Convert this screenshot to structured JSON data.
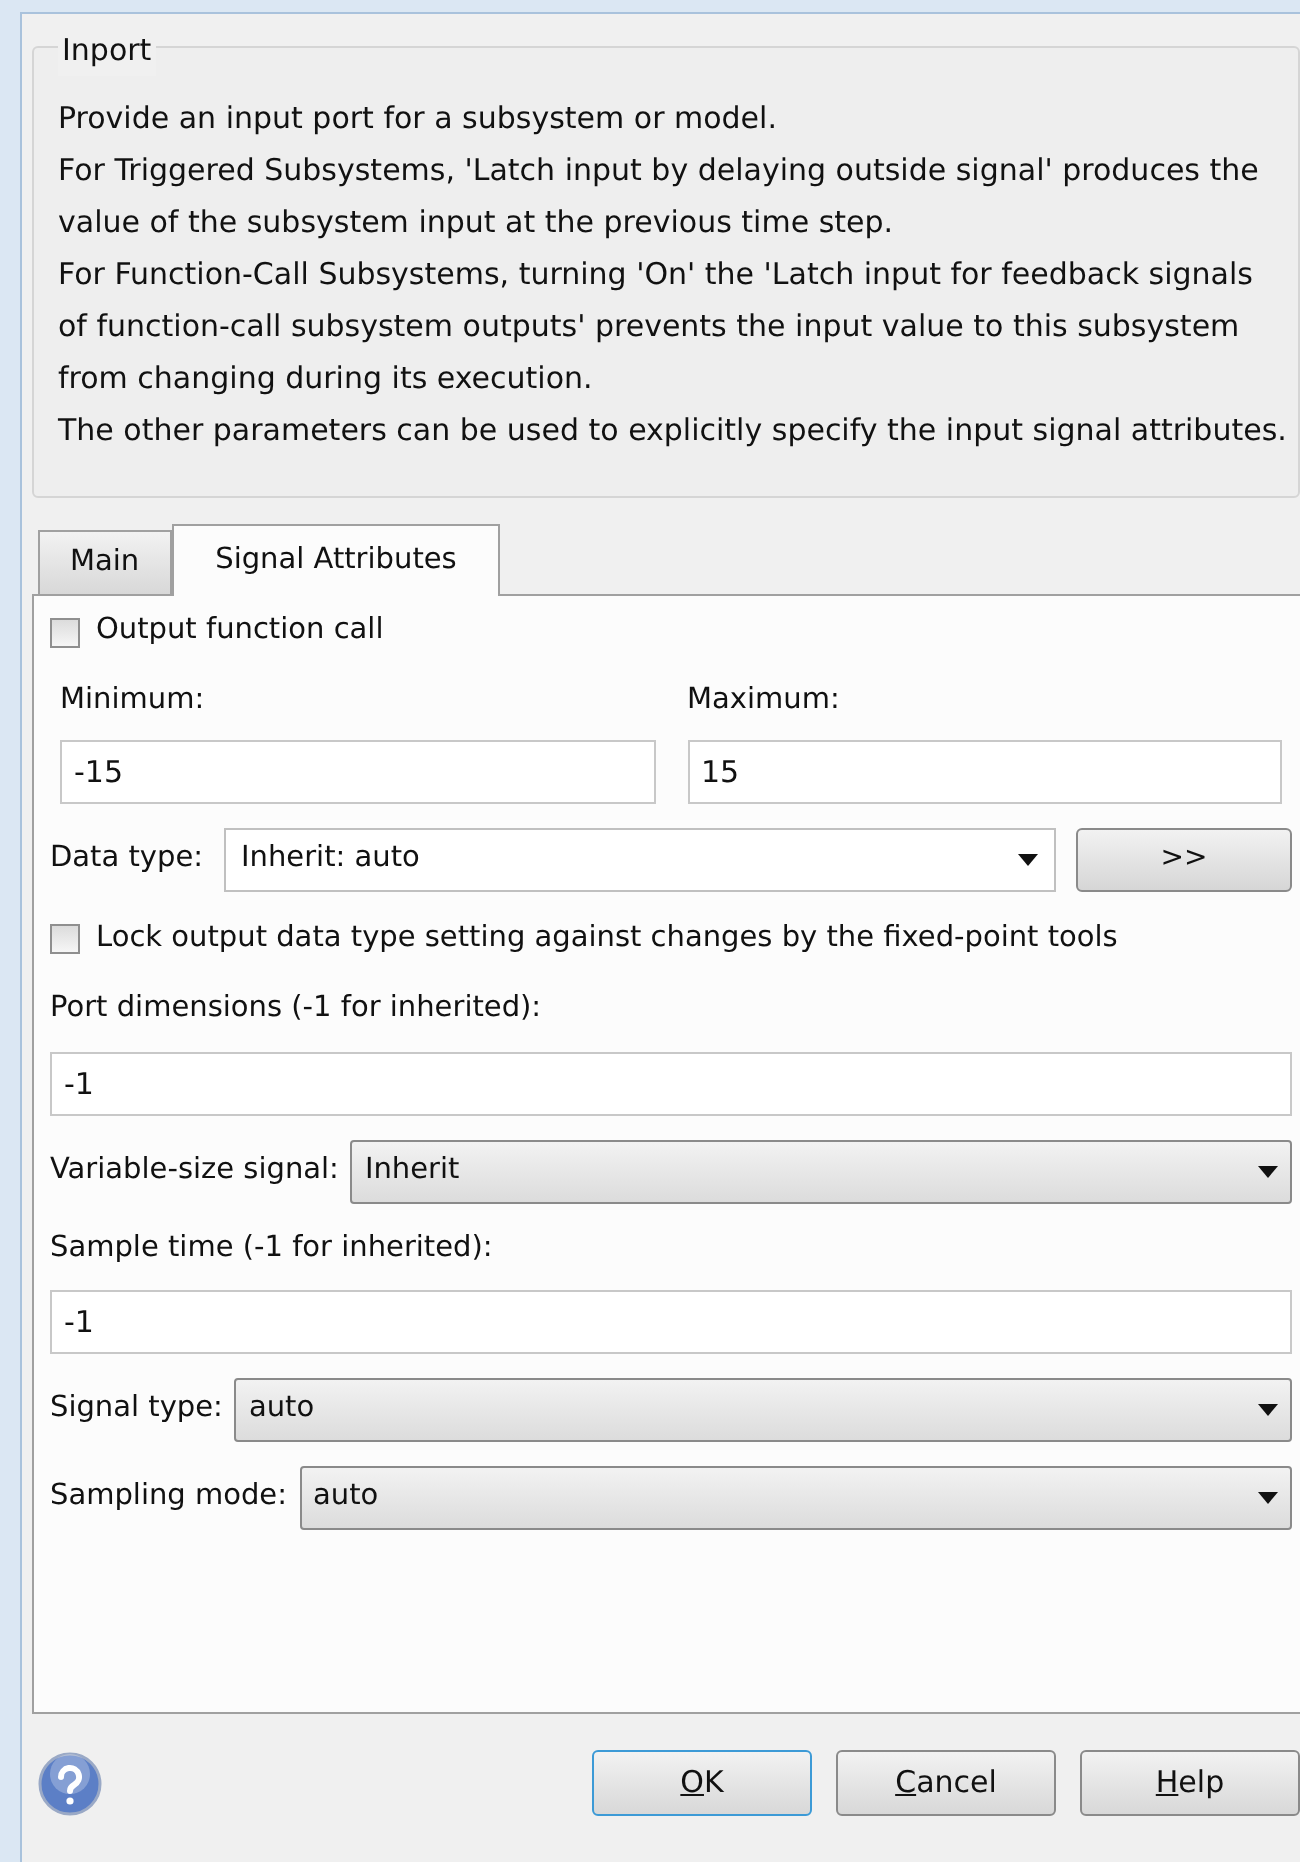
{
  "description": {
    "title": "Inport",
    "paragraphs": [
      "Provide an input port for a subsystem or model.",
      "For Triggered Subsystems, 'Latch input by delaying outside signal' produces the value of the subsystem input at the previous time step.",
      "For Function-Call Subsystems, turning 'On' the 'Latch input for feedback signals of function-call subsystem outputs' prevents the input value to this subsystem from changing during its execution.",
      "The other parameters can be used to explicitly specify the input signal attributes."
    ]
  },
  "tabs": [
    {
      "label": "Main",
      "selected": false
    },
    {
      "label": "Signal Attributes",
      "selected": true
    }
  ],
  "fields": [
    {
      "kind": "checkbox",
      "label": "Output function call",
      "checked": false
    },
    {
      "kind": "pair",
      "items": [
        {
          "label": "Minimum:",
          "value": "-15"
        },
        {
          "label": "Maximum:",
          "value": "15"
        }
      ]
    },
    {
      "kind": "datatype",
      "label": "Data type:",
      "value": "Inherit: auto",
      "button": ">>"
    },
    {
      "kind": "checkbox",
      "label": "Lock output data type setting against changes by the fixed-point tools",
      "checked": false
    },
    {
      "kind": "text",
      "label": "Port dimensions (-1 for inherited):",
      "value": "-1"
    },
    {
      "kind": "select",
      "label": "Variable-size signal:",
      "value": "Inherit"
    },
    {
      "kind": "text",
      "label": "Sample time (-1 for inherited):",
      "value": "-1"
    },
    {
      "kind": "select",
      "label": "Signal type:",
      "value": "auto"
    },
    {
      "kind": "select",
      "label": "Sampling mode:",
      "value": "auto"
    }
  ],
  "buttons": [
    {
      "label": "OK",
      "mnemonic": true,
      "default": true
    },
    {
      "label": "Cancel",
      "mnemonic": true,
      "default": false
    },
    {
      "label": "Help",
      "mnemonic": true,
      "default": false
    }
  ]
}
